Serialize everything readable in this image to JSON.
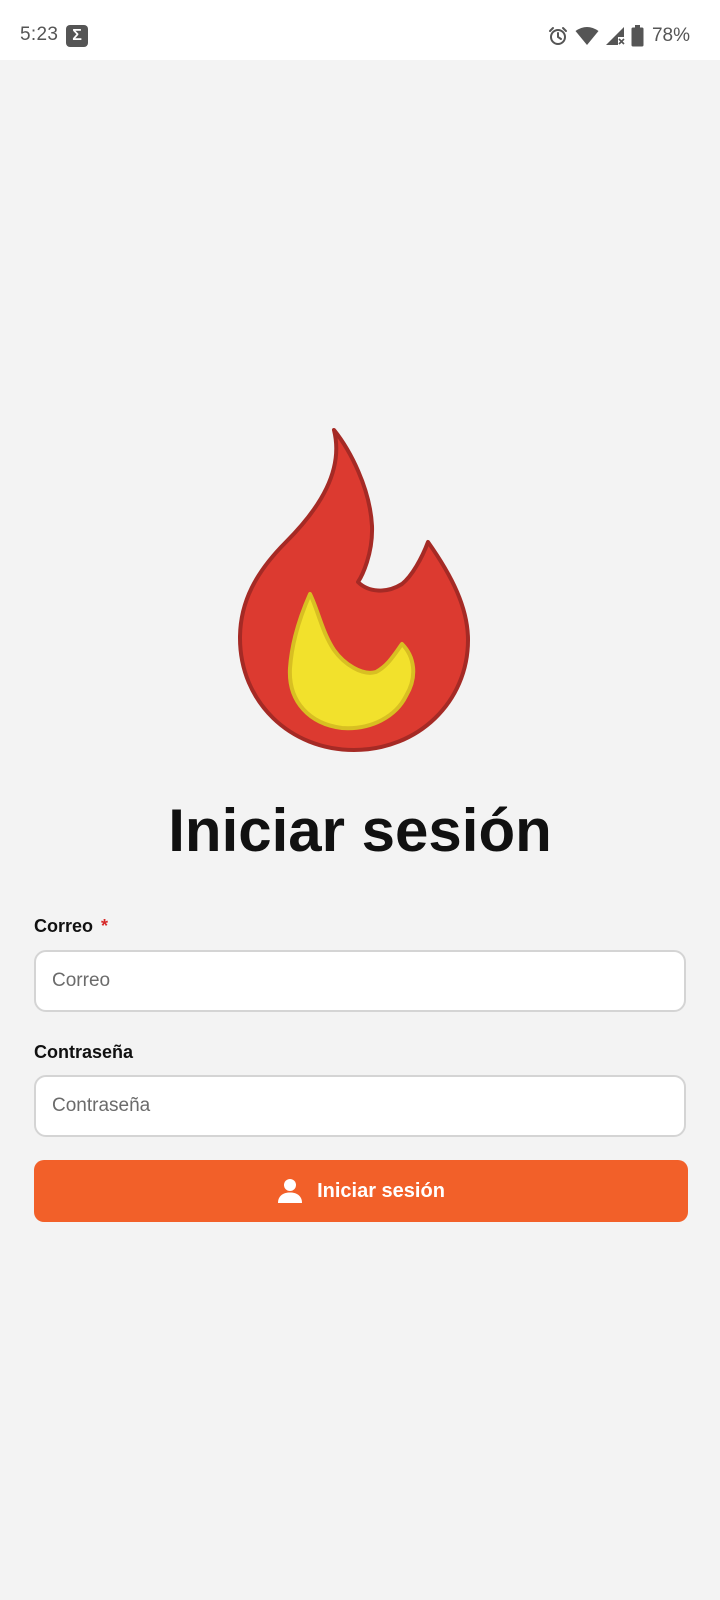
{
  "status_bar": {
    "time": "5:23",
    "notification_icon": "sigma-icon",
    "notification_glyph": "Σ",
    "icons": [
      "alarm-icon",
      "wifi-icon",
      "signal-icon",
      "battery-icon"
    ],
    "battery": "78%"
  },
  "logo": {
    "icon": "flame-icon",
    "colors": {
      "outer": "#dc3a30",
      "outer_stroke": "#a52a25",
      "inner": "#f2e12c",
      "inner_stroke": "#d8bf22"
    }
  },
  "login": {
    "title": "Iniciar sesión",
    "email": {
      "label": "Correo",
      "required_mark": "*",
      "placeholder": "Correo",
      "value": ""
    },
    "password": {
      "label": "Contraseña",
      "placeholder": "Contraseña",
      "value": ""
    },
    "submit": {
      "label": "Iniciar sesión",
      "icon": "user-icon"
    }
  },
  "colors": {
    "background": "#f3f3f3",
    "accent": "#f26029",
    "required": "#d62828"
  }
}
